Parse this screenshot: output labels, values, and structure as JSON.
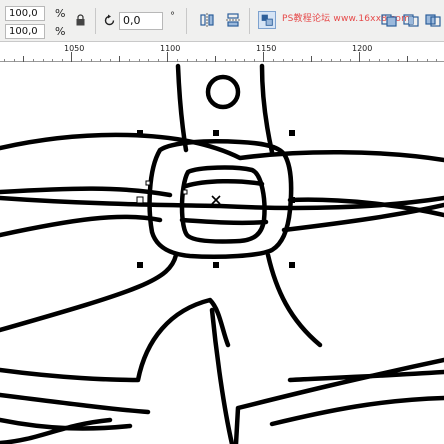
{
  "toolbar": {
    "scale_x": "100,0",
    "scale_y": "100,0",
    "percent_unit": "%",
    "rotation_angle": "0,0",
    "degree_symbol": "°",
    "icons": [
      "lock-ratio-icon",
      "rotate-icon",
      "mirror-horizontal-icon",
      "mirror-vertical-icon",
      "align-icon",
      "wrap-icon",
      "group-icon",
      "combine-icon",
      "weld-icon",
      "trim-icon",
      "intersect-icon",
      "simplify-icon"
    ]
  },
  "watermark": "PS教程论坛 www.16xx8.com",
  "ruler": {
    "labels": [
      "1050",
      "1100",
      "1150",
      "1200"
    ]
  },
  "colors": {
    "accent": "#7ea2cf",
    "watermark": "#e64a4a",
    "stroke": "#000000"
  }
}
